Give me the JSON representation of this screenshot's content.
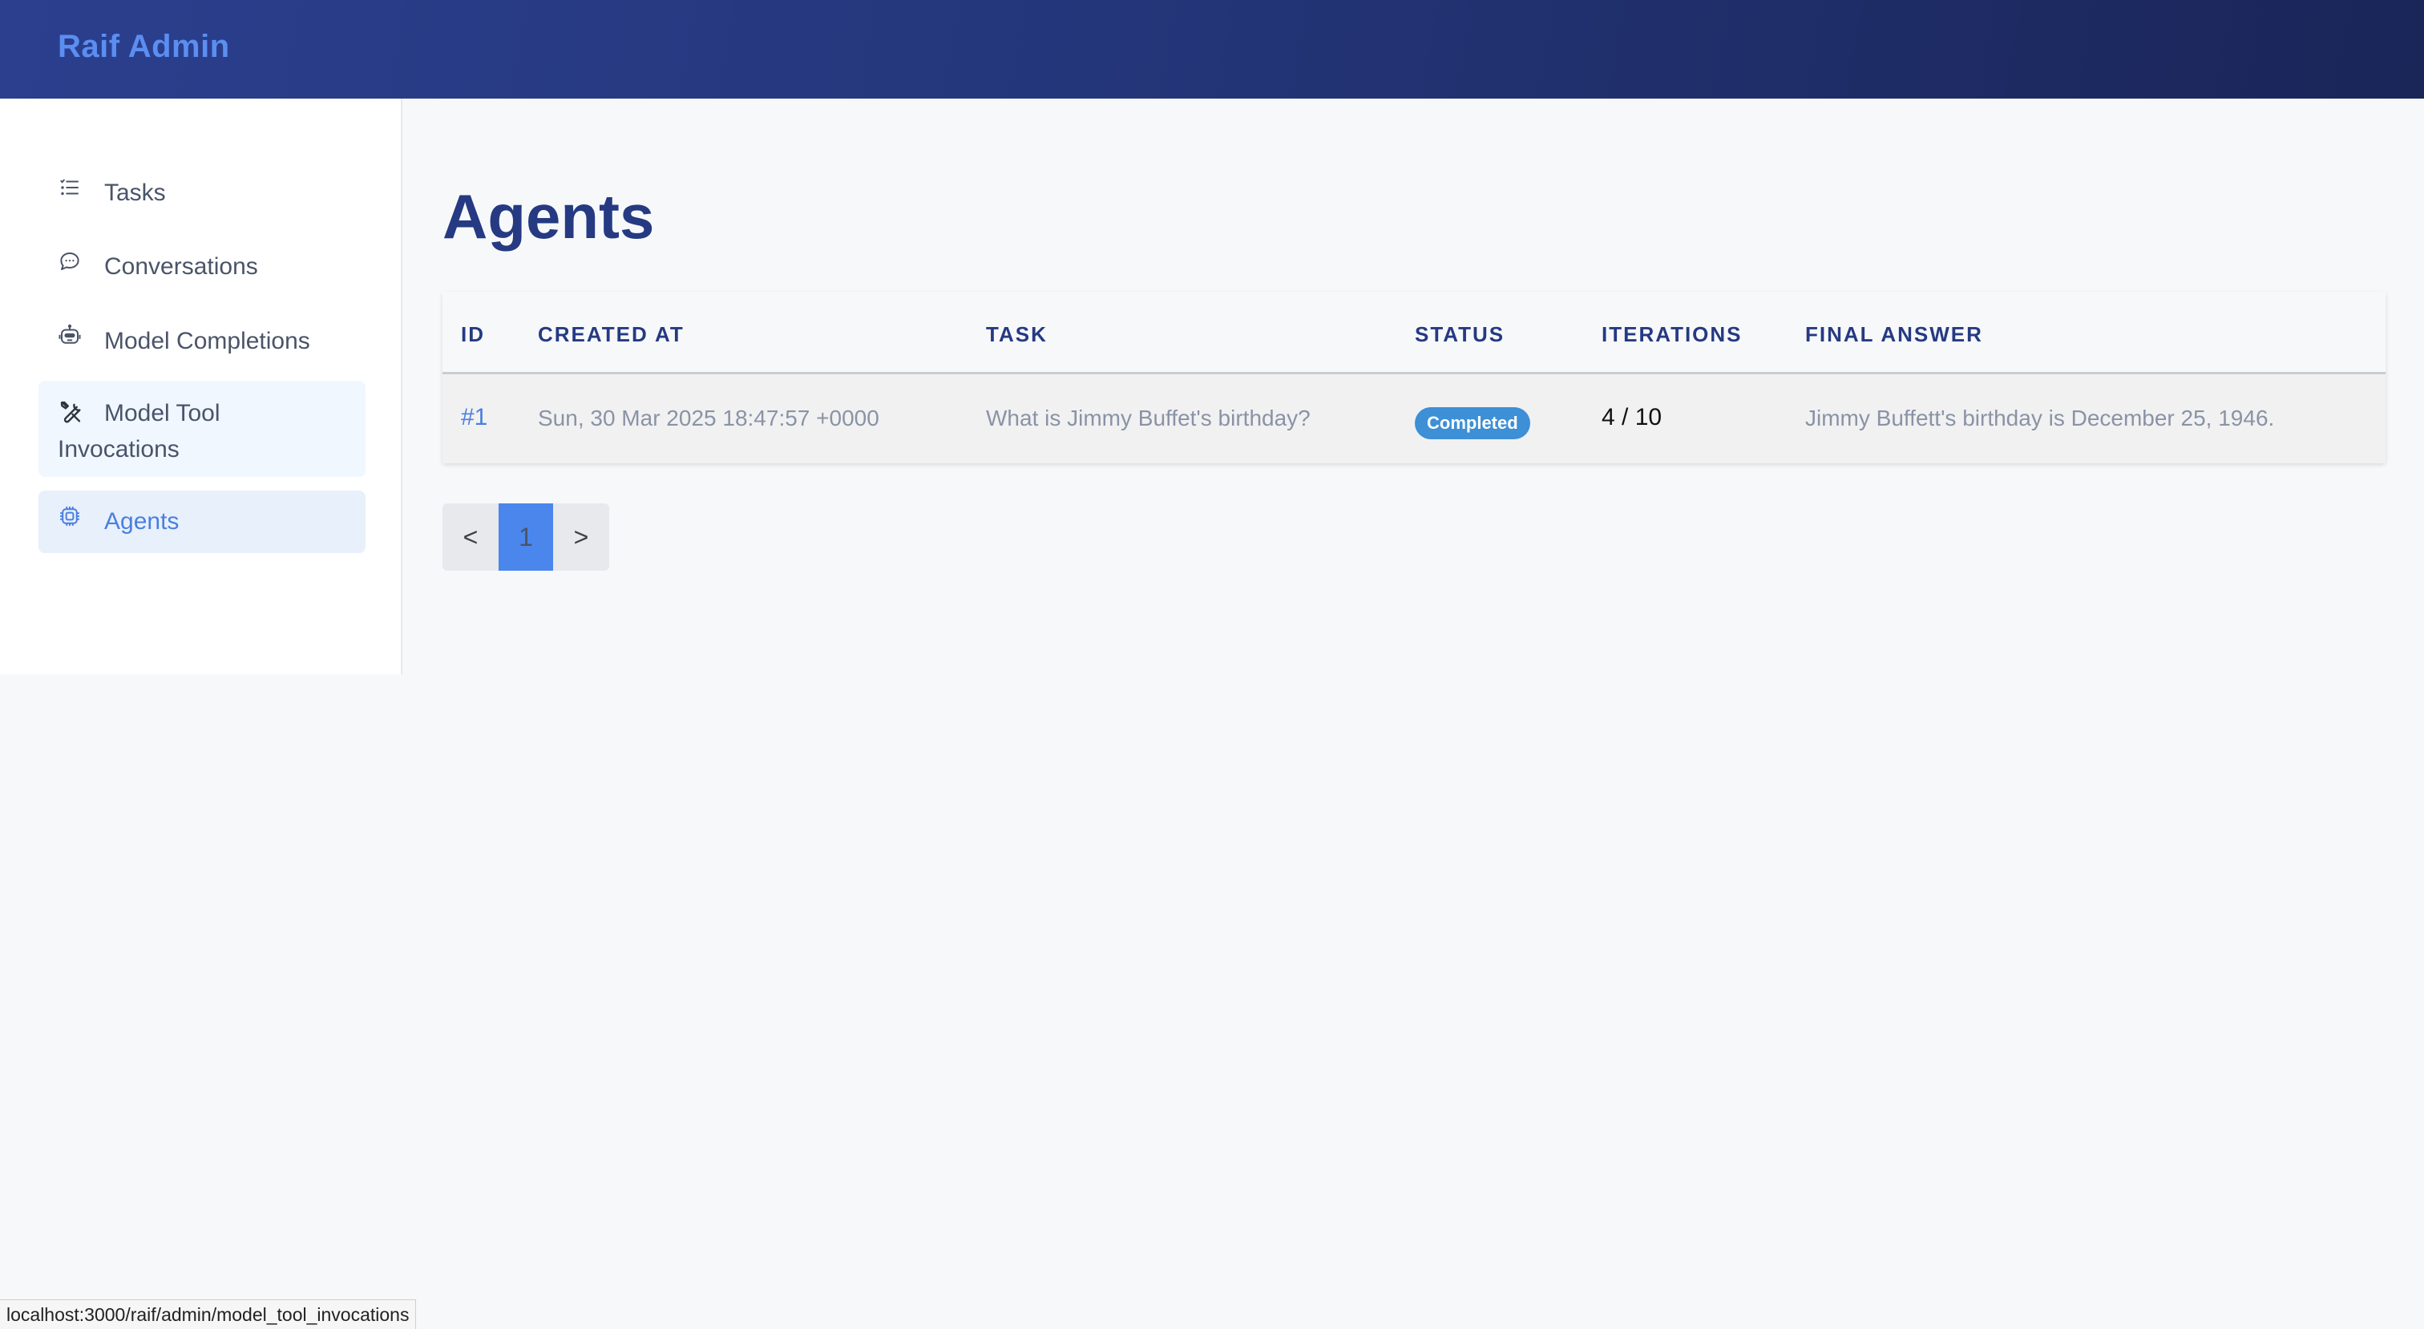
{
  "header": {
    "brand": "Raif Admin"
  },
  "sidebar": {
    "items": [
      {
        "label": "Tasks",
        "icon": "list-icon"
      },
      {
        "label": "Conversations",
        "icon": "chat-bubble-icon"
      },
      {
        "label": "Model Completions",
        "icon": "robot-icon"
      },
      {
        "label": "Model Tool Invocations",
        "icon": "tools-icon"
      },
      {
        "label": "Agents",
        "icon": "cpu-chip-icon",
        "active": true
      }
    ]
  },
  "main": {
    "title": "Agents",
    "table": {
      "columns": [
        "ID",
        "CREATED AT",
        "TASK",
        "STATUS",
        "ITERATIONS",
        "FINAL ANSWER"
      ],
      "rows": [
        {
          "id": "#1",
          "created_at": "Sun, 30 Mar 2025 18:47:57 +0000",
          "task": "What is Jimmy Buffet's birthday?",
          "status": "Completed",
          "iterations": "4 / 10",
          "final_answer": "Jimmy Buffett's birthday is December 25, 1946."
        }
      ]
    },
    "pagination": {
      "prev": "<",
      "current": "1",
      "next": ">"
    }
  },
  "statusbar": {
    "url": "localhost:3000/raif/admin/model_tool_invocations"
  },
  "colors": {
    "header_start": "#2b3f8e",
    "header_end": "#1a2558",
    "brand": "#5b8ef0",
    "title": "#253a82",
    "link": "#4a7fe0",
    "badge": "#3d8fd6",
    "active_page": "#4a86ec"
  }
}
